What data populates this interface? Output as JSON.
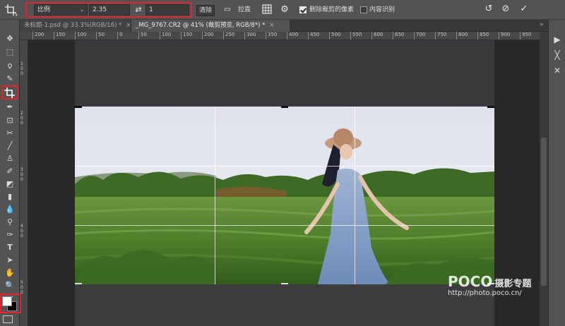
{
  "options_bar": {
    "ratio_preset": "比例",
    "ratio_width": "2.35",
    "swap_icon": "swap-arrows-icon",
    "ratio_height": "1",
    "clear_label": "清除",
    "straighten_label": "拉直",
    "delete_cropped_label": "删除裁剪的像素",
    "delete_cropped_checked": true,
    "content_aware_label": "内容识别",
    "content_aware_checked": false
  },
  "tabs": [
    {
      "label": "未标题-1.psd @ 33.3%(RGB/16) *",
      "close": "×",
      "active": false
    },
    {
      "label": "_MG_9767.CR2 @ 41% (裁剪预览, RGB/8*) *",
      "close": "×",
      "active": true
    }
  ],
  "ruler_ticks": [
    "200",
    "150",
    "100",
    "50",
    "0",
    "50",
    "100",
    "150",
    "200",
    "250",
    "300",
    "350",
    "400",
    "450",
    "500",
    "550",
    "600",
    "650",
    "700",
    "750",
    "800",
    "850",
    "900",
    "950",
    "1000",
    "1050"
  ],
  "tools": [
    "move",
    "marquee",
    "lasso",
    "quick-select",
    "crop",
    "eyedropper",
    "healing",
    "patch",
    "brush",
    "stamp",
    "history-brush",
    "eraser",
    "gradient",
    "blur",
    "dodge",
    "pen",
    "type",
    "path-select",
    "hand",
    "zoom",
    "more"
  ],
  "watermark": {
    "logo": "POCO",
    "title": "摄影专题",
    "url": "http://photo.poco.cn/"
  },
  "colors": {
    "highlight": "#e0232d",
    "foreground": "#ffffff",
    "background": "#000000"
  }
}
